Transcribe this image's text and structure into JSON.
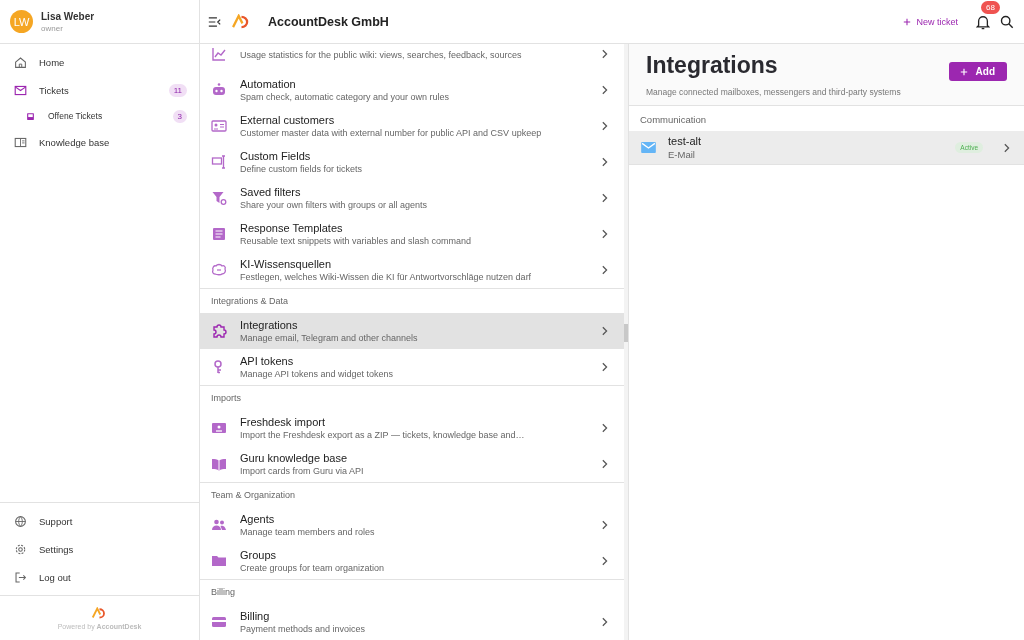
{
  "user": {
    "initials": "LW",
    "name": "Lisa Weber",
    "role": "owner"
  },
  "nav": [
    {
      "label": "Home"
    },
    {
      "label": "Tickets",
      "badge": "11",
      "children": [
        {
          "label": "Offene Tickets",
          "badge": "3"
        }
      ]
    },
    {
      "label": "Knowledge base"
    }
  ],
  "footer_nav": [
    "Support",
    "Settings",
    "Log out"
  ],
  "powered_by": "Powered by **AccountDesk**",
  "header": {
    "company": "AccountDesk GmbH",
    "new_ticket": "New ticket",
    "notifications": "68"
  },
  "settings": [
    {
      "items": [
        {
          "description": "Usage statistics for the public wiki: views, searches, feedback, sources",
          "selected": false
        },
        {
          "title": "Automation",
          "description": "Spam check, automatic category and your own rules",
          "selected": false
        },
        {
          "title": "External customers",
          "description": "Customer master data with external number for public API and CSV upkeep",
          "selected": false
        },
        {
          "title": "Custom Fields",
          "description": "Define custom fields for tickets",
          "selected": false
        },
        {
          "title": "Saved filters",
          "description": "Share your own filters with groups or all agents",
          "selected": false
        },
        {
          "title": "Response Templates",
          "description": "Reusable text snippets with variables and slash command",
          "selected": false
        },
        {
          "title": "KI-Wissensquellen",
          "description": "Festlegen, welches Wiki-Wissen die KI für Antwortvorschläge nutzen darf",
          "selected": false
        }
      ]
    },
    {
      "section": "Integrations & Data",
      "items": [
        {
          "title": "Integrations",
          "description": "Manage email, Telegram and other channels",
          "selected": true
        },
        {
          "title": "API tokens",
          "description": "Manage API tokens and widget tokens",
          "selected": false
        }
      ]
    },
    {
      "section": "Imports",
      "items": [
        {
          "title": "Freshdesk import",
          "description": "Import the Freshdesk export as a ZIP — tickets, knowledge base and…",
          "selected": false
        },
        {
          "title": "Guru knowledge base",
          "description": "Import cards from Guru via API",
          "selected": false
        }
      ]
    },
    {
      "section": "Team & Organization",
      "items": [
        {
          "title": "Agents",
          "description": "Manage team members and roles",
          "selected": false
        },
        {
          "title": "Groups",
          "description": "Create groups for team organization",
          "selected": false
        }
      ]
    },
    {
      "section": "Billing",
      "items": [
        {
          "title": "Billing",
          "description": "Payment methods and invoices",
          "selected": false
        }
      ]
    }
  ],
  "detail": {
    "title": "Integrations",
    "subtitle": "Manage connected mailboxes, messengers and third-party systems",
    "add_button": "Add",
    "groups": [
      {
        "label": "Communication",
        "items": [
          {
            "name": "test-alt",
            "type": "E-Mail",
            "status": "Active",
            "active": true
          }
        ]
      }
    ]
  }
}
